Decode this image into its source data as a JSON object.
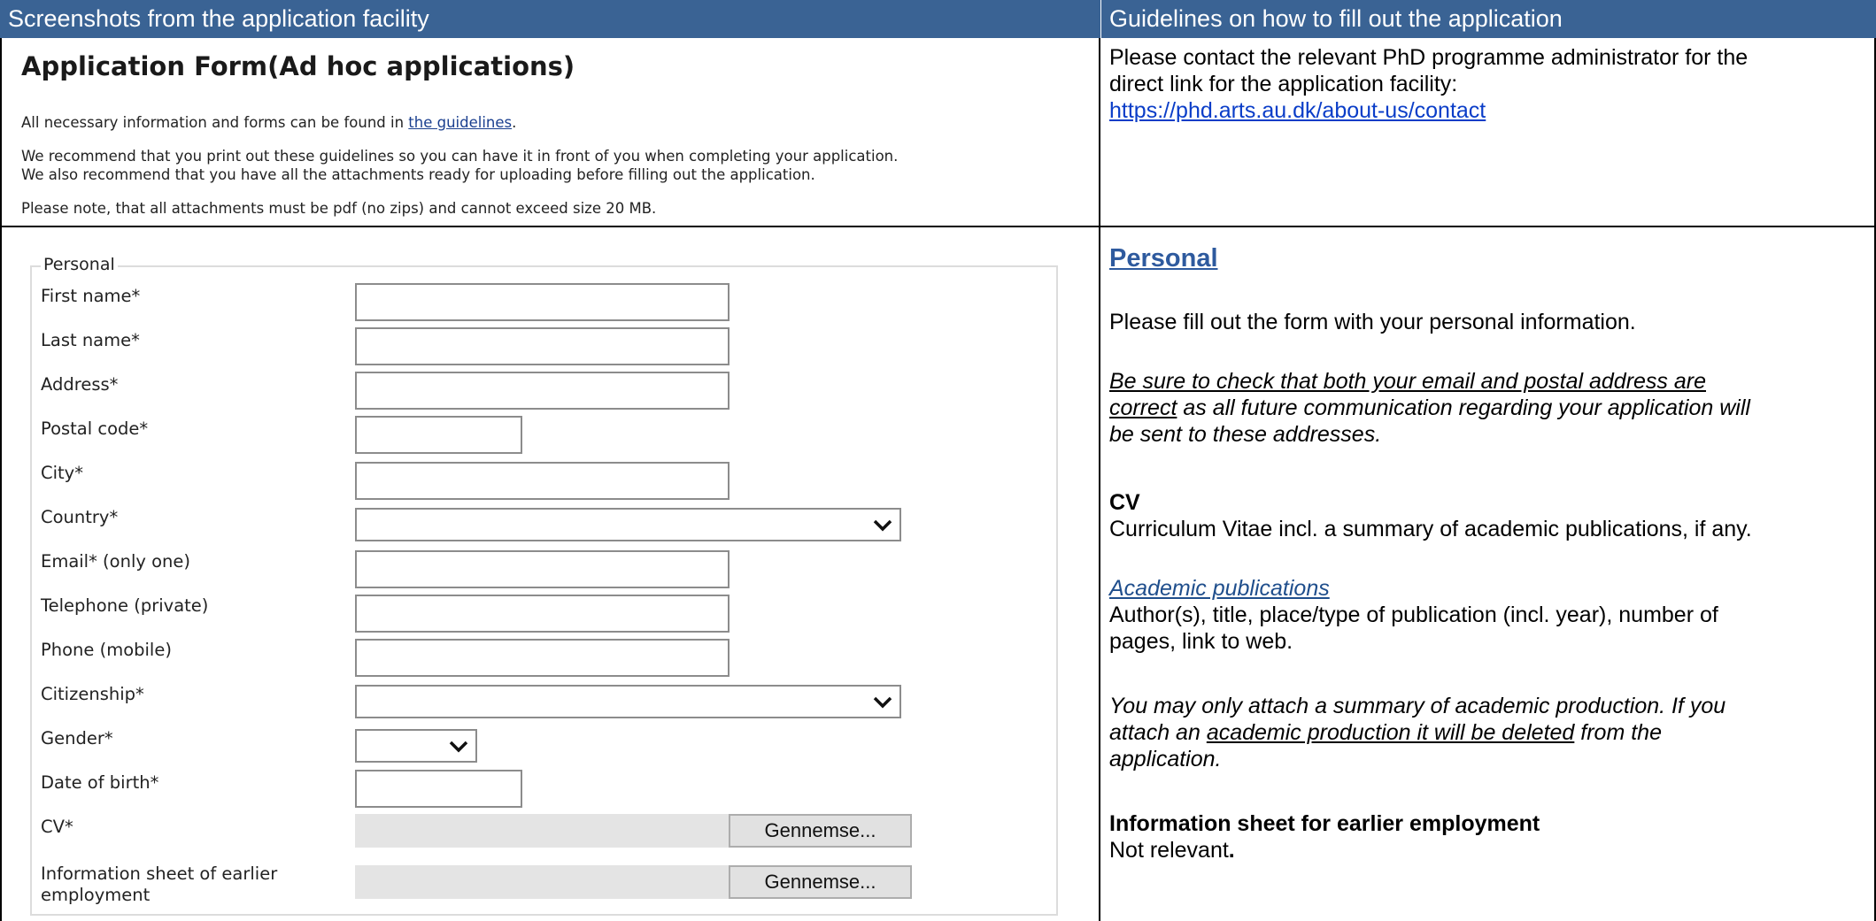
{
  "header": {
    "left": "Screenshots from the application facility",
    "right": "Guidelines on how to fill out the application"
  },
  "form": {
    "title": "Application Form(Ad hoc applications)",
    "intro1_prefix": "All necessary information and forms can be found in ",
    "intro1_link": "the guidelines",
    "intro1_suffix": ".",
    "intro2_line1": "We recommend that you print out these guidelines so you can have it in front of you when completing your application.",
    "intro2_line2": "We also recommend that you have all the attachments ready for uploading before filling out the application.",
    "intro3": "Please note, that all attachments must be pdf (no zips) and cannot exceed size 20 MB.",
    "legend": "Personal",
    "fields": {
      "first_name": "First name*",
      "last_name": "Last name*",
      "address": "Address*",
      "postal_code": "Postal code*",
      "city": "City*",
      "country": "Country*",
      "email": "Email* (only one)",
      "telephone": "Telephone (private)",
      "phone": "Phone (mobile)",
      "citizenship": "Citizenship*",
      "gender": "Gender*",
      "dob": "Date of birth*",
      "cv": "CV*",
      "info_sheet_1": "Information sheet of earlier",
      "info_sheet_2": "employment"
    },
    "browse_label": "Gennemse..."
  },
  "guide": {
    "contact_line1": "Please contact the relevant PhD programme administrator for the",
    "contact_line2": "direct link for the application facility:",
    "contact_link": "https://phd.arts.au.dk/about-us/contact",
    "section_title": "Personal",
    "personal_text": "Please fill out the form with your personal information.",
    "check_u1": "Be sure to check that both your email and postal address are",
    "check_u2": "correct",
    "check_rest1": " as all future communication regarding your application will",
    "check_rest2": "be sent to these addresses.",
    "cv_title": "CV",
    "cv_text": "Curriculum Vitae incl. a summary of academic publications, if any.",
    "pub_title": "Academic publications",
    "pub_text1": "Author(s), title, place/type of publication (incl. year), number of",
    "pub_text2": "pages, link to web.",
    "attach1": "You may only attach a summary of academic production. If you",
    "attach2_pre": "attach an ",
    "attach2_u": "academic production it will be deleted",
    "attach2_post": " from the",
    "attach3": "application.",
    "info_title": "Information sheet for earlier employment",
    "info_text": "Not relevant",
    "info_dot": "."
  }
}
